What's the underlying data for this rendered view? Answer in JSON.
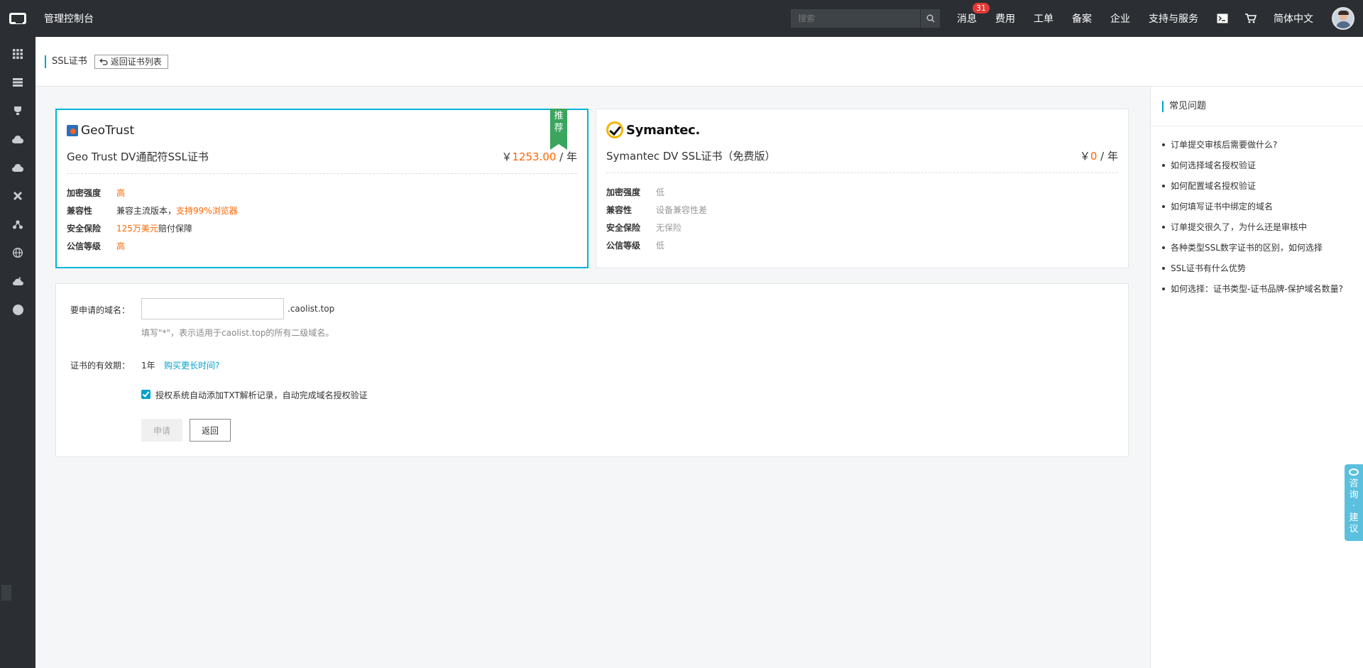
{
  "topbar": {
    "title": "管理控制台",
    "search_placeholder": "搜索",
    "nav": [
      {
        "label": "消息",
        "badge": "31"
      },
      {
        "label": "费用"
      },
      {
        "label": "工单"
      },
      {
        "label": "备案"
      },
      {
        "label": "企业"
      },
      {
        "label": "支持与服务"
      }
    ],
    "language": "简体中文"
  },
  "page": {
    "title": "SSL证书",
    "back_label": "返回证书列表"
  },
  "cards": [
    {
      "brand": "GeoTrust",
      "ribbon": [
        "推",
        "荐"
      ],
      "title": "Geo Trust DV通配符SSL证书",
      "price_currency": "￥",
      "price_value": "1253.00",
      "price_unit": " / 年",
      "attrs": [
        {
          "label": "加密强度",
          "value": "高"
        },
        {
          "label": "兼容性",
          "value": "兼容主流版本，",
          "value_highlight": "支持99%浏览器"
        },
        {
          "label": "安全保险",
          "value_highlight": "125万美元",
          "value": "赔付保障"
        },
        {
          "label": "公信等级",
          "value": "高"
        }
      ]
    },
    {
      "brand": "Symantec.",
      "title": "Symantec DV SSL证书（免费版）",
      "price_currency": "￥",
      "price_value": "0",
      "price_unit": " / 年",
      "attrs": [
        {
          "label": "加密强度",
          "value": "低"
        },
        {
          "label": "兼容性",
          "value": "设备兼容性差"
        },
        {
          "label": "安全保险",
          "value": "无保险"
        },
        {
          "label": "公信等级",
          "value": "低"
        }
      ]
    }
  ],
  "form": {
    "domain_label": "要申请的域名：",
    "domain_value": "",
    "domain_suffix": ".caolist.top",
    "domain_hint": "填写\"*\"，表示适用于caolist.top的所有二级域名。",
    "period_label": "证书的有效期：",
    "period_value": "1年",
    "buy_more_link": "购买更长时间?",
    "auto_txt_label": "授权系统自动添加TXT解析记录，自动完成域名授权验证",
    "apply_button": "申请",
    "back_button": "返回"
  },
  "faq": {
    "title": "常见问题",
    "items": [
      "订单提交审核后需要做什么?",
      "如何选择域名授权验证",
      "如何配置域名授权验证",
      "如何填写证书中绑定的域名",
      "订单提交很久了，为什么还是审核中",
      "各种类型SSL数字证书的区别，如何选择",
      "SSL证书有什么优势",
      "如何选择：证书类型-证书品牌-保护域名数量?"
    ]
  },
  "consult": [
    "咨",
    "询",
    "·",
    "建",
    "议"
  ],
  "colors": {
    "accent": "#00a2ca",
    "price": "#ff6600",
    "topbar": "#2b2f33",
    "ribbon": "#3aa55c"
  }
}
